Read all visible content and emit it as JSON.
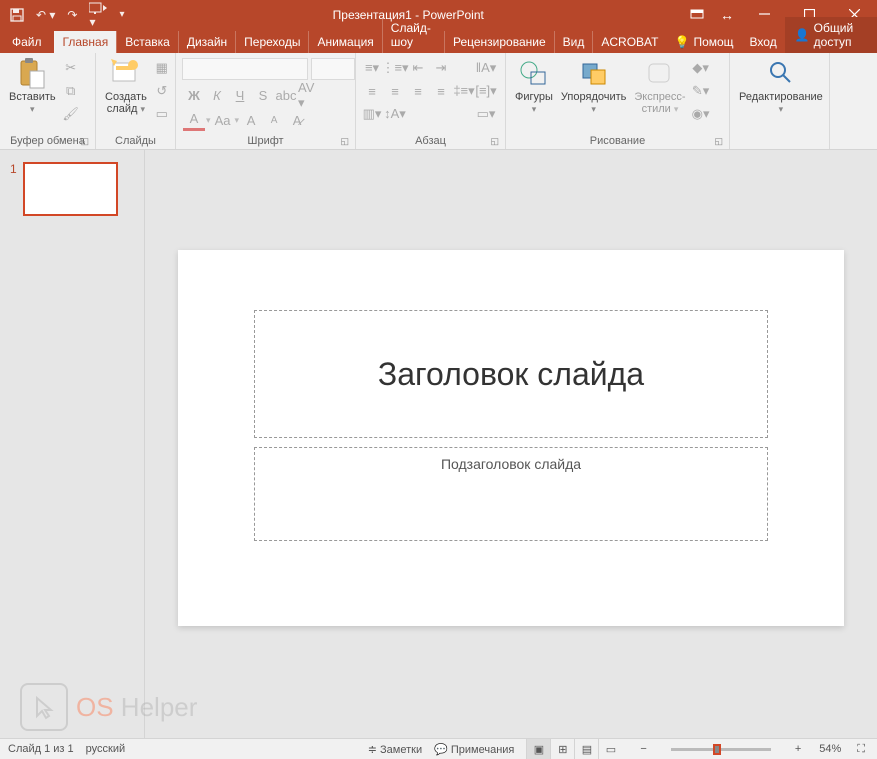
{
  "titlebar": {
    "title": "Презентация1 - PowerPoint"
  },
  "tabs": {
    "file": "Файл",
    "home": "Главная",
    "insert": "Вставка",
    "design": "Дизайн",
    "transitions": "Переходы",
    "animations": "Анимация",
    "slideshow": "Слайд-шоу",
    "review": "Рецензирование",
    "view": "Вид",
    "acrobat": "ACROBAT",
    "help": "Помощ",
    "login": "Вход",
    "share": "Общий доступ"
  },
  "ribbon": {
    "clipboard": {
      "label": "Буфер обмена",
      "paste": "Вставить"
    },
    "slides": {
      "label": "Слайды",
      "new": "Создать\nслайд"
    },
    "font": {
      "label": "Шрифт",
      "bold": "Ж",
      "italic": "К",
      "underline": "Ч",
      "strike": "S",
      "a_up": "A",
      "aa": "Aa",
      "a_sup": "A",
      "a_sub": "A"
    },
    "paragraph": {
      "label": "Абзац"
    },
    "drawing": {
      "label": "Рисование",
      "shapes": "Фигуры",
      "arrange": "Упорядочить",
      "styles": "Экспресс-\nстили"
    },
    "editing": {
      "label": "Редактирование"
    }
  },
  "thumbs": {
    "num1": "1"
  },
  "slide": {
    "title": "Заголовок слайда",
    "subtitle": "Подзаголовок слайда"
  },
  "status": {
    "slide": "Слайд 1 из 1",
    "lang": "русский",
    "notes": "Заметки",
    "comments": "Примечания",
    "zoom": "54%",
    "minus": "−",
    "plus": "+"
  },
  "watermark": {
    "os": "OS",
    "helper": " Helper"
  }
}
